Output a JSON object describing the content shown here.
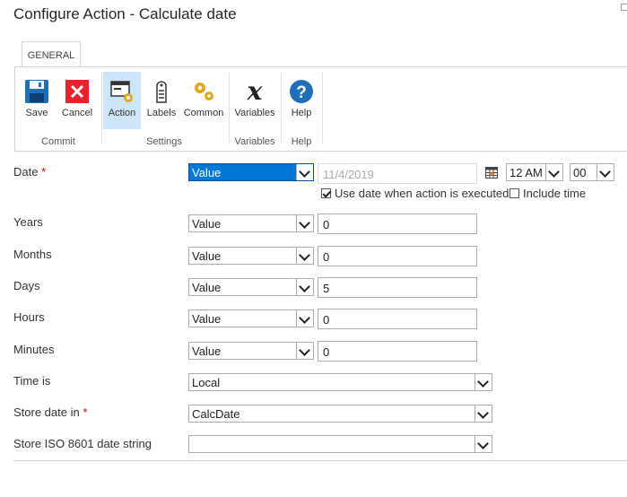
{
  "dialog": {
    "title": "Configure Action - Calculate date"
  },
  "ribbon": {
    "tab_label": "GENERAL",
    "buttons": {
      "save": "Save",
      "cancel": "Cancel",
      "action": "Action",
      "labels": "Labels",
      "common": "Common",
      "variables": "Variables",
      "help": "Help"
    },
    "groups": {
      "commit": "Commit",
      "settings": "Settings",
      "variables": "Variables",
      "help": "Help"
    }
  },
  "form": {
    "date": {
      "label": "Date",
      "required_mark": "*",
      "type": "Value",
      "value": "11/4/2019",
      "hour": "12 AM",
      "minute": "00",
      "use_date_executed_label": "Use date when action is executed",
      "use_date_executed": true,
      "include_time_label": "Include time",
      "include_time": false
    },
    "years": {
      "label": "Years",
      "type": "Value",
      "value": "0"
    },
    "months": {
      "label": "Months",
      "type": "Value",
      "value": "0"
    },
    "days": {
      "label": "Days",
      "type": "Value",
      "value": "5"
    },
    "hours": {
      "label": "Hours",
      "type": "Value",
      "value": "0"
    },
    "minutes": {
      "label": "Minutes",
      "type": "Value",
      "value": "0"
    },
    "time_is": {
      "label": "Time is",
      "value": "Local"
    },
    "store_date_in": {
      "label": "Store date in",
      "required_mark": "*",
      "value": "CalcDate"
    },
    "store_iso": {
      "label": "Store ISO 8601 date string",
      "value": ""
    }
  }
}
